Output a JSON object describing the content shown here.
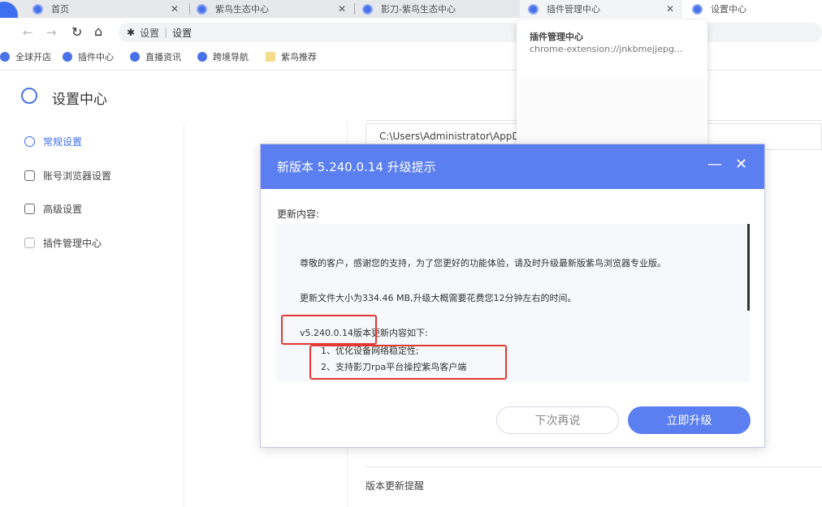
{
  "tabs": [
    {
      "label": "首页"
    },
    {
      "label": "紫鸟生态中心"
    },
    {
      "label": "影刀-紫鸟生态中心"
    },
    {
      "label": "插件管理中心"
    },
    {
      "label": "设置中心"
    }
  ],
  "toolbar": {
    "address_prefix": "设置",
    "address": "设置"
  },
  "bookmarks": [
    {
      "label": "全球开店"
    },
    {
      "label": "插件中心"
    },
    {
      "label": "直播资讯"
    },
    {
      "label": "跨境导航"
    },
    {
      "label": "紫鸟推荐"
    }
  ],
  "tab_preview": {
    "title": "插件管理中心",
    "url": "chrome-extension://jnkbmejjepg..."
  },
  "page": {
    "title": "设置中心",
    "path_value": "C:\\Users\\Administrator\\AppData\\Local\\SuperBrowser",
    "bottom_row": "版本更新提醒"
  },
  "sidebar": {
    "items": [
      {
        "label": "常规设置"
      },
      {
        "label": "账号浏览器设置"
      },
      {
        "label": "高级设置"
      },
      {
        "label": "插件管理中心"
      }
    ]
  },
  "dialog": {
    "title": "新版本 5.240.0.14 升级提示",
    "content_label": "更新内容:",
    "para1": "尊敬的客户，感谢您的支持，为了您更好的功能体验，请及时升级最新版紫鸟浏览器专业版。",
    "para2": "更新文件大小为334.46 MB,升级大概需要花费您12分钟左右的时间。",
    "version_heading": "v5.240.0.14版本更新内容如下:",
    "items": [
      "1、优化设备网络稳定性;",
      "2、支持影刀rpa平台操控紫鸟客户端"
    ],
    "later_label": "下次再说",
    "upgrade_label": "立即升级"
  },
  "colors": {
    "accent": "#5b7ef0",
    "highlight": "#e03a33"
  }
}
